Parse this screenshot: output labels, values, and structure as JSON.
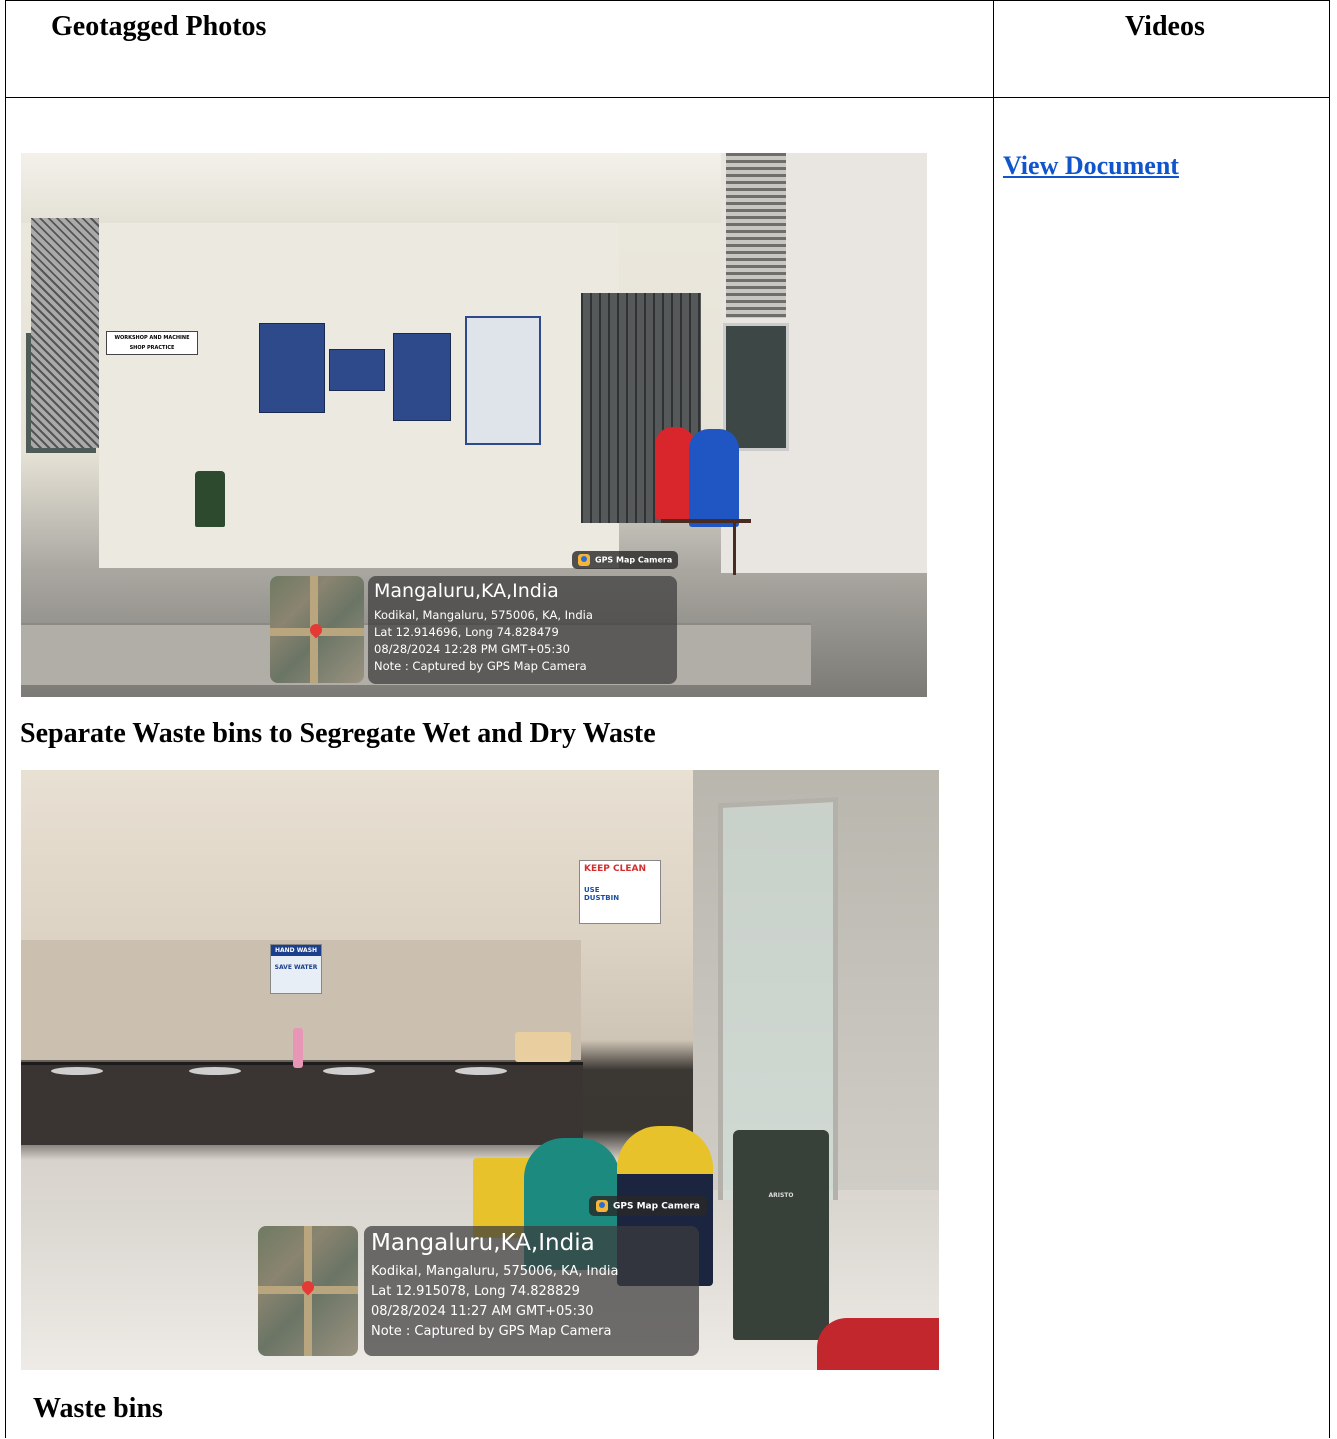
{
  "headers": {
    "photos": "Geotagged Photos",
    "videos": "Videos"
  },
  "link": {
    "label": "View Document"
  },
  "photos": [
    {
      "caption": "Separate Waste bins to Segregate Wet and Dry Waste",
      "gps_badge": "GPS Map Camera",
      "gps_title": "Mangaluru,KA,India",
      "gps_address": "Kodikal, Mangaluru, 575006, KA, India",
      "gps_coords": "Lat 12.914696, Long 74.828479",
      "gps_datetime": "08/28/2024 12:28 PM GMT+05:30",
      "gps_note": "Note : Captured by GPS Map Camera",
      "sign_text": "WORKSHOP AND MACHINE SHOP PRACTICE"
    },
    {
      "caption": "Waste bins",
      "gps_badge": "GPS Map Camera",
      "gps_title": "Mangaluru,KA,India",
      "gps_address": "Kodikal, Mangaluru, 575006, KA, India",
      "gps_coords": "Lat 12.915078, Long 74.828829",
      "gps_datetime": "08/28/2024 11:27 AM GMT+05:30",
      "gps_note": "Note : Captured by GPS Map Camera",
      "sign_keep_clean": "KEEP CLEAN",
      "sign_use_dustbin": "USE DUSTBIN",
      "sign_hand_wash": "HAND WASH",
      "sign_save_water": "SAVE WATER",
      "bin_brand": "ARISTO"
    }
  ],
  "colors": {
    "link": "#1155cc",
    "bin_red": "#d8262c",
    "bin_blue": "#1f56c4",
    "bin_green": "#2e4a2e",
    "bin_teal": "#1d8a80",
    "bin_yellow": "#e7c22a",
    "bin_dark": "#38403a"
  }
}
